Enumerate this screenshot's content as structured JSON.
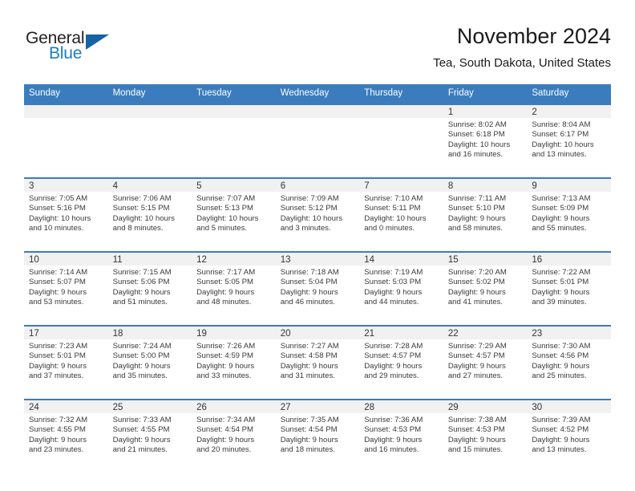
{
  "brand": {
    "name_part1": "General",
    "name_part2": "Blue",
    "triangle_color": "#1464a5",
    "blue": "#1a7dc4"
  },
  "header": {
    "title": "November 2024",
    "subtitle": "Tea, South Dakota, United States"
  },
  "theme": {
    "header_bg": "#3b7cbe",
    "daynum_bg": "#f1f1f1",
    "grid_line": "#3b7cbe"
  },
  "weekdays": [
    "Sunday",
    "Monday",
    "Tuesday",
    "Wednesday",
    "Thursday",
    "Friday",
    "Saturday"
  ],
  "weeks": [
    [
      {
        "day": "",
        "sunrise": "",
        "sunset": "",
        "daylight1": "",
        "daylight2": "",
        "empty": true
      },
      {
        "day": "",
        "sunrise": "",
        "sunset": "",
        "daylight1": "",
        "daylight2": "",
        "empty": true
      },
      {
        "day": "",
        "sunrise": "",
        "sunset": "",
        "daylight1": "",
        "daylight2": "",
        "empty": true
      },
      {
        "day": "",
        "sunrise": "",
        "sunset": "",
        "daylight1": "",
        "daylight2": "",
        "empty": true
      },
      {
        "day": "",
        "sunrise": "",
        "sunset": "",
        "daylight1": "",
        "daylight2": "",
        "empty": true
      },
      {
        "day": "1",
        "sunrise": "Sunrise: 8:02 AM",
        "sunset": "Sunset: 6:18 PM",
        "daylight1": "Daylight: 10 hours",
        "daylight2": "and 16 minutes."
      },
      {
        "day": "2",
        "sunrise": "Sunrise: 8:04 AM",
        "sunset": "Sunset: 6:17 PM",
        "daylight1": "Daylight: 10 hours",
        "daylight2": "and 13 minutes."
      }
    ],
    [
      {
        "day": "3",
        "sunrise": "Sunrise: 7:05 AM",
        "sunset": "Sunset: 5:16 PM",
        "daylight1": "Daylight: 10 hours",
        "daylight2": "and 10 minutes."
      },
      {
        "day": "4",
        "sunrise": "Sunrise: 7:06 AM",
        "sunset": "Sunset: 5:15 PM",
        "daylight1": "Daylight: 10 hours",
        "daylight2": "and 8 minutes."
      },
      {
        "day": "5",
        "sunrise": "Sunrise: 7:07 AM",
        "sunset": "Sunset: 5:13 PM",
        "daylight1": "Daylight: 10 hours",
        "daylight2": "and 5 minutes."
      },
      {
        "day": "6",
        "sunrise": "Sunrise: 7:09 AM",
        "sunset": "Sunset: 5:12 PM",
        "daylight1": "Daylight: 10 hours",
        "daylight2": "and 3 minutes."
      },
      {
        "day": "7",
        "sunrise": "Sunrise: 7:10 AM",
        "sunset": "Sunset: 5:11 PM",
        "daylight1": "Daylight: 10 hours",
        "daylight2": "and 0 minutes."
      },
      {
        "day": "8",
        "sunrise": "Sunrise: 7:11 AM",
        "sunset": "Sunset: 5:10 PM",
        "daylight1": "Daylight: 9 hours",
        "daylight2": "and 58 minutes."
      },
      {
        "day": "9",
        "sunrise": "Sunrise: 7:13 AM",
        "sunset": "Sunset: 5:09 PM",
        "daylight1": "Daylight: 9 hours",
        "daylight2": "and 55 minutes."
      }
    ],
    [
      {
        "day": "10",
        "sunrise": "Sunrise: 7:14 AM",
        "sunset": "Sunset: 5:07 PM",
        "daylight1": "Daylight: 9 hours",
        "daylight2": "and 53 minutes."
      },
      {
        "day": "11",
        "sunrise": "Sunrise: 7:15 AM",
        "sunset": "Sunset: 5:06 PM",
        "daylight1": "Daylight: 9 hours",
        "daylight2": "and 51 minutes."
      },
      {
        "day": "12",
        "sunrise": "Sunrise: 7:17 AM",
        "sunset": "Sunset: 5:05 PM",
        "daylight1": "Daylight: 9 hours",
        "daylight2": "and 48 minutes."
      },
      {
        "day": "13",
        "sunrise": "Sunrise: 7:18 AM",
        "sunset": "Sunset: 5:04 PM",
        "daylight1": "Daylight: 9 hours",
        "daylight2": "and 46 minutes."
      },
      {
        "day": "14",
        "sunrise": "Sunrise: 7:19 AM",
        "sunset": "Sunset: 5:03 PM",
        "daylight1": "Daylight: 9 hours",
        "daylight2": "and 44 minutes."
      },
      {
        "day": "15",
        "sunrise": "Sunrise: 7:20 AM",
        "sunset": "Sunset: 5:02 PM",
        "daylight1": "Daylight: 9 hours",
        "daylight2": "and 41 minutes."
      },
      {
        "day": "16",
        "sunrise": "Sunrise: 7:22 AM",
        "sunset": "Sunset: 5:01 PM",
        "daylight1": "Daylight: 9 hours",
        "daylight2": "and 39 minutes."
      }
    ],
    [
      {
        "day": "17",
        "sunrise": "Sunrise: 7:23 AM",
        "sunset": "Sunset: 5:01 PM",
        "daylight1": "Daylight: 9 hours",
        "daylight2": "and 37 minutes."
      },
      {
        "day": "18",
        "sunrise": "Sunrise: 7:24 AM",
        "sunset": "Sunset: 5:00 PM",
        "daylight1": "Daylight: 9 hours",
        "daylight2": "and 35 minutes."
      },
      {
        "day": "19",
        "sunrise": "Sunrise: 7:26 AM",
        "sunset": "Sunset: 4:59 PM",
        "daylight1": "Daylight: 9 hours",
        "daylight2": "and 33 minutes."
      },
      {
        "day": "20",
        "sunrise": "Sunrise: 7:27 AM",
        "sunset": "Sunset: 4:58 PM",
        "daylight1": "Daylight: 9 hours",
        "daylight2": "and 31 minutes."
      },
      {
        "day": "21",
        "sunrise": "Sunrise: 7:28 AM",
        "sunset": "Sunset: 4:57 PM",
        "daylight1": "Daylight: 9 hours",
        "daylight2": "and 29 minutes."
      },
      {
        "day": "22",
        "sunrise": "Sunrise: 7:29 AM",
        "sunset": "Sunset: 4:57 PM",
        "daylight1": "Daylight: 9 hours",
        "daylight2": "and 27 minutes."
      },
      {
        "day": "23",
        "sunrise": "Sunrise: 7:30 AM",
        "sunset": "Sunset: 4:56 PM",
        "daylight1": "Daylight: 9 hours",
        "daylight2": "and 25 minutes."
      }
    ],
    [
      {
        "day": "24",
        "sunrise": "Sunrise: 7:32 AM",
        "sunset": "Sunset: 4:55 PM",
        "daylight1": "Daylight: 9 hours",
        "daylight2": "and 23 minutes."
      },
      {
        "day": "25",
        "sunrise": "Sunrise: 7:33 AM",
        "sunset": "Sunset: 4:55 PM",
        "daylight1": "Daylight: 9 hours",
        "daylight2": "and 21 minutes."
      },
      {
        "day": "26",
        "sunrise": "Sunrise: 7:34 AM",
        "sunset": "Sunset: 4:54 PM",
        "daylight1": "Daylight: 9 hours",
        "daylight2": "and 20 minutes."
      },
      {
        "day": "27",
        "sunrise": "Sunrise: 7:35 AM",
        "sunset": "Sunset: 4:54 PM",
        "daylight1": "Daylight: 9 hours",
        "daylight2": "and 18 minutes."
      },
      {
        "day": "28",
        "sunrise": "Sunrise: 7:36 AM",
        "sunset": "Sunset: 4:53 PM",
        "daylight1": "Daylight: 9 hours",
        "daylight2": "and 16 minutes."
      },
      {
        "day": "29",
        "sunrise": "Sunrise: 7:38 AM",
        "sunset": "Sunset: 4:53 PM",
        "daylight1": "Daylight: 9 hours",
        "daylight2": "and 15 minutes."
      },
      {
        "day": "30",
        "sunrise": "Sunrise: 7:39 AM",
        "sunset": "Sunset: 4:52 PM",
        "daylight1": "Daylight: 9 hours",
        "daylight2": "and 13 minutes."
      }
    ]
  ]
}
